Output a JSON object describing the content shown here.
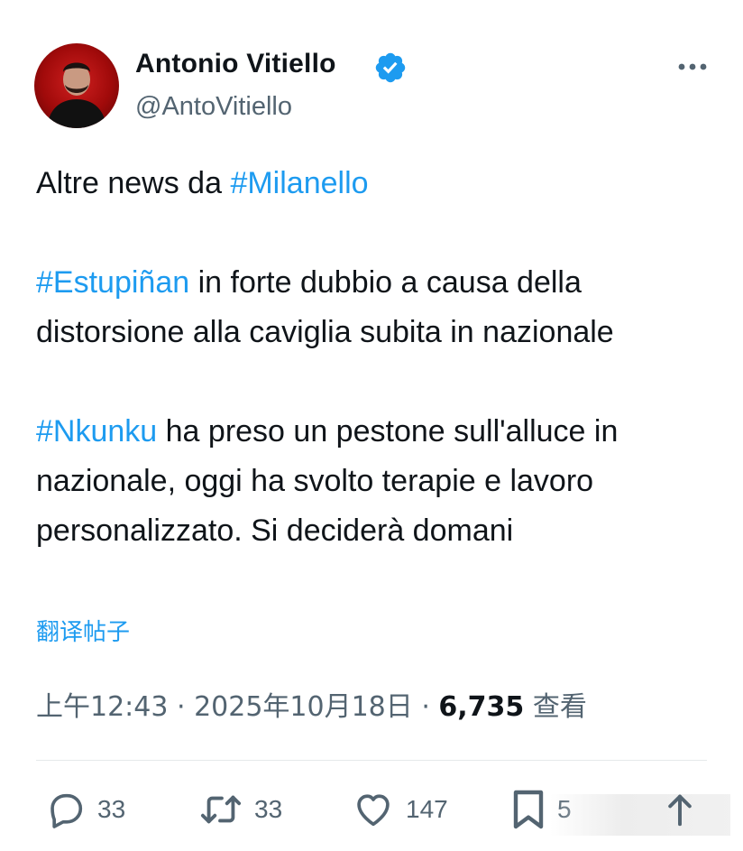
{
  "author": {
    "display_name": "Antonio Vitiello",
    "handle": "@AntoVitiello",
    "verified": true,
    "avatar_icon": "avatar-portrait"
  },
  "tweet": {
    "line1_prefix": "Altre news da ",
    "line1_hashtag": "#Milanello",
    "para2_hashtag": "#Estupiñan",
    "para2_text": " in forte dubbio a causa della distorsione alla caviglia subita in nazionale",
    "para3_hashtag": "#Nkunku",
    "para3_text": " ha preso un pestone sull'alluce in nazionale, oggi ha svolto terapie e lavoro personalizzato. Si deciderà domani"
  },
  "translate_label": "翻译帖子",
  "meta": {
    "time": "上午12:43",
    "sep1": " · ",
    "date": "2025年10月18日",
    "sep2": " · ",
    "views_count": "6,735",
    "views_label": " 查看"
  },
  "actions": {
    "replies": "33",
    "reposts": "33",
    "likes": "147",
    "bookmarks": "5"
  },
  "colors": {
    "accent": "#1d9bf0",
    "text": "#0f1419",
    "secondary": "#536471"
  }
}
